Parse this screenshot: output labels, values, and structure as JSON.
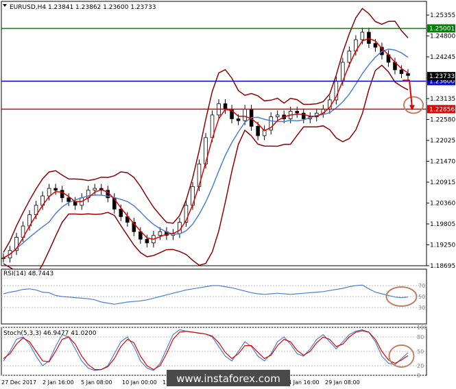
{
  "chart_data": [
    {
      "type": "candlestick",
      "title": "EURUSD,H4  1.23841 1.23862 1.23600 1.23733",
      "symbol": "EURUSD,H4",
      "ohlc": {
        "open": 1.23841,
        "high": 1.23862,
        "low": 1.236,
        "close": 1.23733
      },
      "ylim": [
        1.18695,
        1.25355
      ],
      "y_ticks": [
        "1.25355",
        "1.24800",
        "1.24245",
        "1.23690",
        "1.23135",
        "1.22580",
        "1.22025",
        "1.21470",
        "1.20915",
        "1.20360",
        "1.19805",
        "1.19250",
        "1.18695"
      ],
      "x_tick_labels": [
        "27 Dec 2017",
        "2 Jan 16:00",
        "5 Jan 08:00",
        "10 Jan 00:00",
        "12",
        "4 Jan 16:00",
        "29 Jan 08:00"
      ],
      "horizontal_levels": [
        {
          "value": 1.25001,
          "label": "1.25001",
          "color": "#008000"
        },
        {
          "value": 1.236,
          "label": "1.23600",
          "color": "#0000cc"
        },
        {
          "value": 1.22856,
          "label": "1.22856",
          "color": "#e00000"
        }
      ],
      "price_label": {
        "value": 1.23733,
        "label": "1.23733"
      },
      "close_series": [
        1.189,
        1.191,
        1.1945,
        1.1975,
        1.2005,
        1.203,
        1.2055,
        1.2075,
        1.207,
        1.205,
        1.204,
        1.203,
        1.205,
        1.207,
        1.2075,
        1.207,
        1.205,
        1.202,
        1.2,
        1.1985,
        1.196,
        1.194,
        1.193,
        1.195,
        1.196,
        1.195,
        1.1955,
        1.1985,
        1.203,
        1.208,
        1.214,
        1.221,
        1.227,
        1.23,
        1.2285,
        1.226,
        1.2255,
        1.2285,
        1.224,
        1.2215,
        1.223,
        1.2265,
        1.227,
        1.226,
        1.228,
        1.2275,
        1.226,
        1.2265,
        1.2275,
        1.2285,
        1.231,
        1.236,
        1.241,
        1.244,
        1.247,
        1.249,
        1.246,
        1.245,
        1.243,
        1.241,
        1.239,
        1.238,
        1.2375
      ]
    },
    {
      "type": "line",
      "title": "RSI(14) 48.7443",
      "ylim": [
        0,
        100
      ],
      "y_ticks": [
        "70",
        "50",
        "30"
      ],
      "values": [
        55,
        58,
        60,
        63,
        64,
        62,
        58,
        57,
        52,
        50,
        49,
        48,
        47,
        46,
        44,
        40,
        38,
        36,
        38,
        40,
        41,
        42,
        44,
        47,
        50,
        53,
        56,
        59,
        62,
        64,
        66,
        68,
        70,
        70,
        68,
        66,
        63,
        60,
        57,
        55,
        54,
        55,
        56,
        55,
        54,
        55,
        56,
        57,
        58,
        59,
        61,
        63,
        65,
        68,
        70,
        71,
        64,
        58,
        55,
        52,
        49,
        48,
        49
      ]
    },
    {
      "type": "line",
      "title": "Stoch(5,3,3) 46.9477 41.0200",
      "ylim": [
        0,
        100
      ],
      "y_ticks": [
        "100",
        "80",
        "50",
        "20",
        "0"
      ],
      "main": [
        30,
        50,
        75,
        80,
        65,
        40,
        20,
        30,
        60,
        85,
        80,
        55,
        30,
        15,
        10,
        12,
        20,
        45,
        70,
        80,
        60,
        30,
        15,
        10,
        25,
        55,
        85,
        95,
        92,
        90,
        88,
        86,
        80,
        60,
        40,
        30,
        50,
        70,
        60,
        40,
        30,
        45,
        70,
        80,
        65,
        45,
        40,
        55,
        75,
        85,
        70,
        55,
        70,
        85,
        92,
        95,
        90,
        70,
        40,
        25,
        22,
        35,
        47
      ],
      "signal": [
        35,
        45,
        65,
        78,
        70,
        50,
        30,
        28,
        50,
        75,
        80,
        65,
        40,
        22,
        12,
        12,
        18,
        35,
        60,
        75,
        68,
        40,
        20,
        12,
        20,
        45,
        75,
        90,
        92,
        90,
        88,
        86,
        82,
        68,
        48,
        35,
        45,
        62,
        62,
        48,
        35,
        42,
        62,
        75,
        70,
        52,
        42,
        50,
        68,
        80,
        75,
        60,
        65,
        80,
        90,
        93,
        90,
        75,
        50,
        32,
        25,
        32,
        41
      ]
    }
  ],
  "watermark": "www.instaforex.com"
}
